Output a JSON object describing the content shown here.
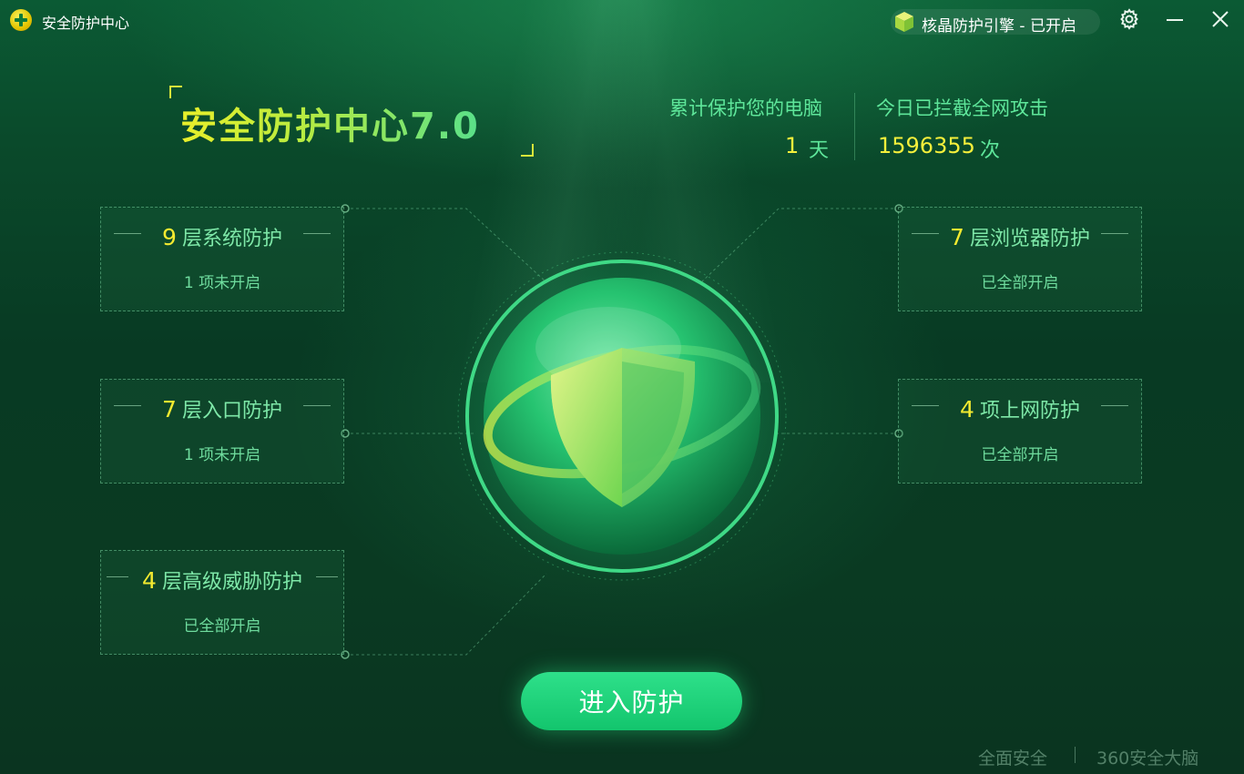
{
  "titlebar": {
    "app_title": "安全防护中心",
    "engine_status": "核晶防护引擎 - 已开启"
  },
  "product": {
    "title": "安全防护中心7.0"
  },
  "stats": {
    "protected_label": "累计保护您的电脑",
    "protected_value": "1",
    "protected_unit": "天",
    "blocked_label": "今日已拦截全网攻击",
    "blocked_value": "1596355",
    "blocked_unit": "次"
  },
  "cards": {
    "system": {
      "num": "9",
      "label": "层系统防护",
      "status": "1 项未开启"
    },
    "entry": {
      "num": "7",
      "label": "层入口防护",
      "status": "1 项未开启"
    },
    "threat": {
      "num": "4",
      "label": "层高级威胁防护",
      "status": "已全部开启"
    },
    "browser": {
      "num": "7",
      "label": "层浏览器防护",
      "status": "已全部开启"
    },
    "network": {
      "num": "4",
      "label": "项上网防护",
      "status": "已全部开启"
    }
  },
  "enter_button": "进入防护",
  "footer": {
    "left": "全面安全",
    "right": "360安全大脑"
  },
  "colors": {
    "accent_yellow": "#f3ea30",
    "accent_green": "#5ee69a",
    "button_green": "#1fd47b",
    "background": "#0a4a2b"
  },
  "icons": [
    "app-logo-icon",
    "engine-cube-icon",
    "gear-icon",
    "minimize-icon",
    "close-icon",
    "shield-icon"
  ]
}
